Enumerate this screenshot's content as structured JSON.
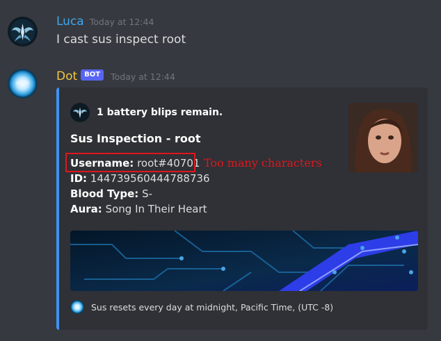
{
  "messages": [
    {
      "author": "Luca",
      "author_color": "#3fa8ef",
      "timestamp": "Today at 12:44",
      "text": "I cast sus inspect root",
      "avatar_icon": "winged-emblem-icon"
    },
    {
      "author": "Dot",
      "author_color": "#f2c744",
      "bot_tag": "BOT",
      "timestamp": "Today at 12:44",
      "avatar_icon": "glowing-orb-icon"
    }
  ],
  "embed": {
    "accent_color": "#3f93f3",
    "author_name": "1 battery blips remain.",
    "title": "Sus Inspection - root",
    "fields": [
      {
        "label": "Username:",
        "value": "root#40701"
      },
      {
        "label": "ID:",
        "value": "144739560444788736"
      },
      {
        "label": "Blood Type:",
        "value": "S-"
      },
      {
        "label": "Aura:",
        "value": "Song In Their Heart"
      }
    ],
    "footer": "Sus resets every day at midnight, Pacific Time, (UTC -8)"
  },
  "annotation": {
    "text": "Too many characters",
    "color": "#e0161e"
  }
}
